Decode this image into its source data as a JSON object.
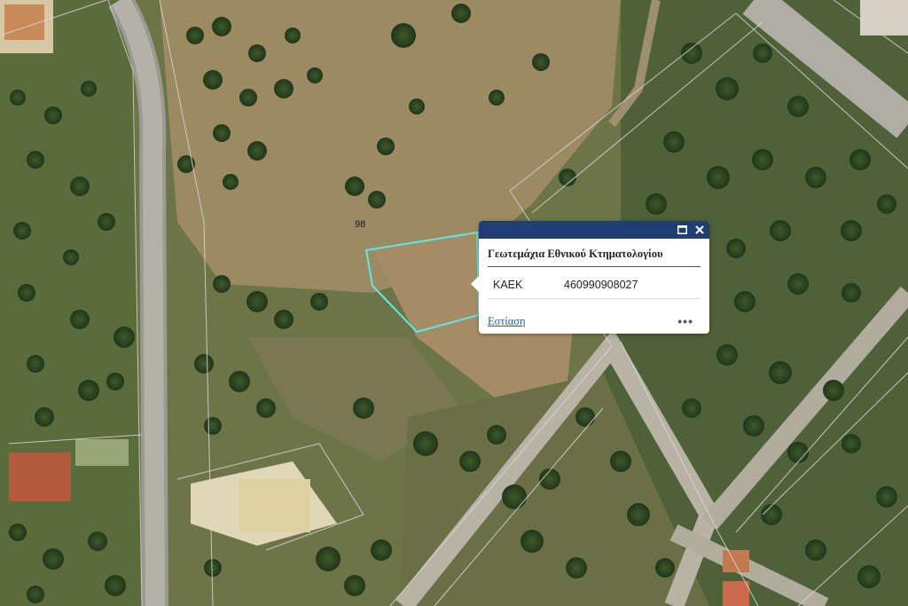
{
  "map": {
    "parcel_number_label": "98",
    "highlight_color": "#5fe6e6",
    "boundary_color": "#d8d8d8"
  },
  "popup": {
    "title": "Γεωτεμάχια Εθνικού Κτηματολογίου",
    "attributes": [
      {
        "key": "ΚΑΕΚ",
        "value": "460990908027"
      }
    ],
    "zoom_label": "Εστίαση",
    "more_label": "•••",
    "header_color": "#1f3f73",
    "maximize_icon": "maximize-icon",
    "close_icon": "close-icon"
  }
}
